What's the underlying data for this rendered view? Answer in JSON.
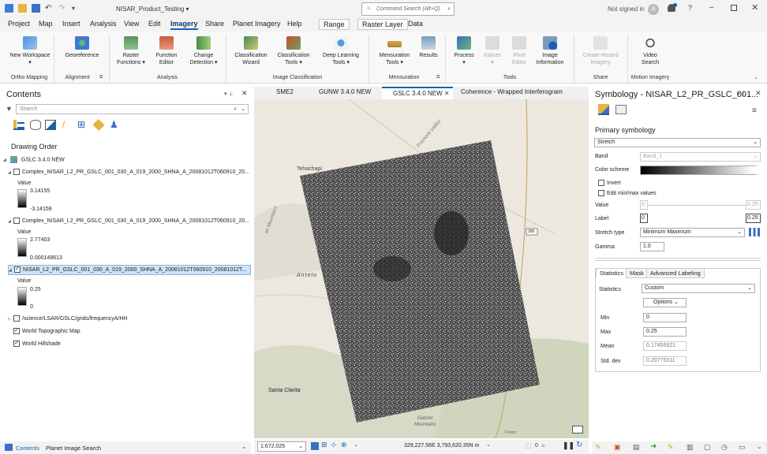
{
  "titlebar": {
    "title": "NISAR_Product_Testing",
    "command_search_placeholder": "Command Search (Alt+Q)",
    "signin": "Not signed in",
    "user_initial": "A"
  },
  "menu": {
    "tabs": [
      "Project",
      "Map",
      "Insert",
      "Analysis",
      "View",
      "Edit",
      "Imagery",
      "Share",
      "Planet Imagery",
      "Help",
      "Range",
      "Raster Layer",
      "Data"
    ],
    "active": "Imagery"
  },
  "ribbon": {
    "buttons": {
      "new_workspace": "New Workspace",
      "georeference": "Georeference",
      "raster_functions": "Raster Functions",
      "function_editor": "Function Editor",
      "change_detection": "Change Detection",
      "classification_wizard": "Classification Wizard",
      "classification_tools": "Classification Tools",
      "deep_learning_tools": "Deep Learning Tools",
      "mensuration_tools": "Mensuration Tools",
      "results": "Results",
      "process": "Process",
      "indices": "Indices",
      "pixel_editor": "Pixel Editor",
      "image_information": "Image Information",
      "create_hosted_imagery": "Create Hosted Imagery",
      "video_search": "Video Search"
    },
    "groups": {
      "ortho_mapping": "Ortho Mapping",
      "alignment": "Alignment",
      "analysis": "Analysis",
      "image_classification": "Image Classification",
      "mensuration": "Mensuration",
      "tools": "Tools",
      "share": "Share",
      "motion_imagery": "Motion Imagery"
    }
  },
  "contents": {
    "title": "Contents",
    "search_placeholder": "Search",
    "drawing_order": "Drawing Order",
    "map_name": "GSLC 3.4.0 NEW",
    "layers": [
      {
        "name": "Complex_NISAR_L2_PR_GSLC_001_030_A_019_2000_SHNA_A_20081012T060910_20...",
        "checked": false,
        "legend_title": "Value",
        "high": "3.14155",
        "low": "-3.14159"
      },
      {
        "name": "Complex_NISAR_L2_PR_GSLC_001_030_A_019_2000_SHNA_A_20081012T060910_20...",
        "checked": false,
        "legend_title": "Value",
        "high": "2.77403",
        "low": "0.000149613"
      },
      {
        "name": "NISAR_L2_PR_GSLC_001_030_A_019_2000_SHNA_A_20081012T060910_20081012T...",
        "checked": true,
        "legend_title": "Value",
        "high": "0.25",
        "low": "0"
      }
    ],
    "other_layers": [
      {
        "name": "/science/LSAR/GSLC/grids/frequencyA/HH",
        "checked": false
      },
      {
        "name": "World Topographic Map",
        "checked": true
      },
      {
        "name": "World Hillshade",
        "checked": true
      }
    ],
    "bottom_tabs": [
      "Contents",
      "Planet Image Search"
    ]
  },
  "map": {
    "tabs": [
      "SME2",
      "GUNW 3.4.0 NEW",
      "GSLC 3.4.0 NEW",
      "Coherence - Wrapped Interferogram"
    ],
    "active_tab": "GSLC 3.4.0 NEW",
    "labels": {
      "tehachapi": "Tehachapi",
      "fremont_valley": "Fremont Valley",
      "antelope": "Antelo",
      "santa_clarita": "Santa Clarita",
      "route": "395",
      "mountains": "Mountains",
      "gabriel": "Gabriel",
      "mountains2": "Mountains",
      "mts": "ter Mountains",
      "forest": "Forest"
    },
    "scale": "1:672,025",
    "coordinates": "329,227.56E 3,793,620.35N m",
    "zero_count": "0"
  },
  "symbology": {
    "title": "Symbology - NISAR_L2_PR_GSLC_001...",
    "primary": "Primary symbology",
    "renderer": "Stretch",
    "band_label": "Band",
    "band_value": "Band_1",
    "color_scheme_label": "Color scheme",
    "invert": "Invert",
    "edit_minmax": "Edit min/max values",
    "value_label": "Value",
    "value_min": "0",
    "value_max": "0.25",
    "label_label": "Label",
    "label_min": "0",
    "label_max": "0.25",
    "stretch_type_label": "Stretch type",
    "stretch_type": "Minimum Maximum",
    "gamma_label": "Gamma",
    "gamma": "1.0",
    "tabs": [
      "Statistics",
      "Mask",
      "Advanced Labeling"
    ],
    "statistics_label": "Statistics",
    "statistics_value": "Custom",
    "options": "Options",
    "min_label": "Min",
    "min": "0",
    "max_label": "Max",
    "max": "0.25",
    "mean_label": "Mean",
    "mean": "0.17455921",
    "std_label": "Std. dev",
    "std": "0.20775311"
  },
  "colors": {
    "accent": "#1a5fb4",
    "ribbon_bg": "#f8f8f8",
    "map_bg": "#ede9e1"
  }
}
